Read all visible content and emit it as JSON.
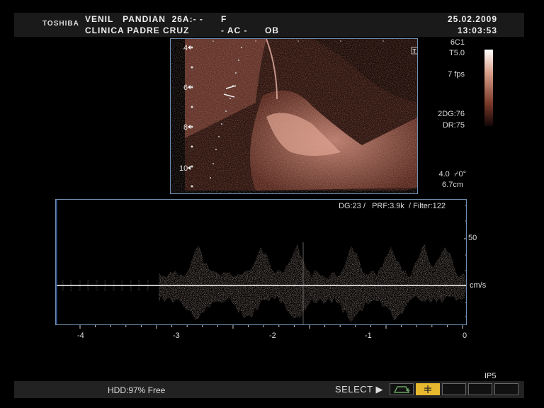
{
  "header": {
    "brand": "TOSHIBA",
    "patient_name": "VENIL   PANDIAN  26A:- -",
    "sex": "F",
    "clinic": "CLINICA PADRE CRUZ",
    "ac": "- AC -",
    "dept": "OB",
    "date": "25.02.2009",
    "time": "13:03:53"
  },
  "bmode": {
    "depth_labels": [
      "4",
      "6",
      "8",
      "10"
    ],
    "marker": "T"
  },
  "side_panel": {
    "probe": "6C1",
    "freq": "T5.0",
    "fps": "7 fps",
    "gain_2d": "2DG:76",
    "dynamic_range": "DR:75",
    "angle": "4.0  ⌿0°",
    "depth": "6.7cm"
  },
  "doppler": {
    "params": "DG:23 /   PRF:3.9k  / Filter:122",
    "velocity_label": "50",
    "unit": "cm/s",
    "time_labels": [
      "-4",
      "-3",
      "-2",
      "-1",
      "0"
    ]
  },
  "status": {
    "hdd": "HDD:97% Free",
    "select": "SELECT ▶",
    "mode_label": "IP5"
  },
  "colors": {
    "frame_border": "#6f8fb0",
    "highlight_button": "#e6b830",
    "tissue": "#b07060"
  }
}
